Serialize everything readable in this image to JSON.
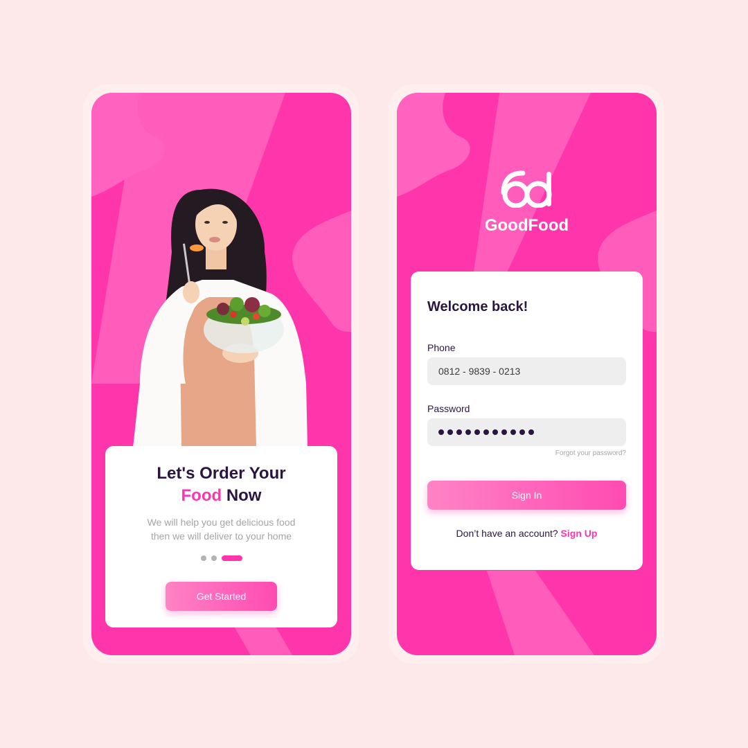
{
  "colors": {
    "page_background": "#fde9e9",
    "brand_pink": "#ff36ab",
    "light_pink": "#ff83c5",
    "text_dark": "#2a1540",
    "text_muted": "#a5a5a5",
    "input_background": "#eeeeee"
  },
  "onboarding": {
    "title_line1": "Let's Order Your",
    "title_accent": "Food",
    "title_rest": "Now",
    "description": "We will help you get delicious food then we will deliver to your home",
    "pagination": {
      "total": 3,
      "active": 3
    },
    "get_started_label": "Get Started",
    "photo_icon": "woman-eating-salad-photo"
  },
  "login": {
    "logo_icon": "goodfood-logo-icon",
    "brand_name": "GoodFood",
    "welcome": "Welcome back!",
    "phone_label": "Phone",
    "phone_value": "0812 - 9839 - 0213",
    "password_label": "Password",
    "password_mask": "●●●●●●●●●●●",
    "forgot_password": "Forgot your password?",
    "sign_in_label": "Sign In",
    "no_account_text": "Don’t have an account?",
    "sign_up_label": "Sign Up"
  }
}
